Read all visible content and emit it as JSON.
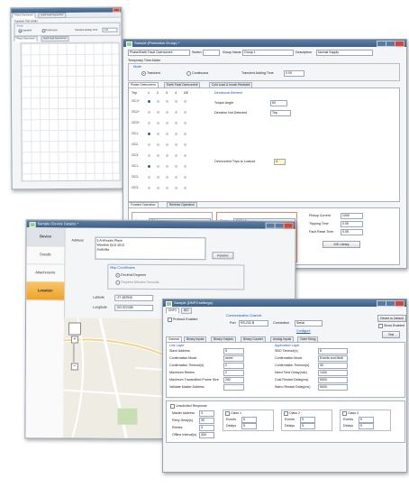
{
  "windows": {
    "transient": {
      "title": "Transient Time Adder",
      "tabs": [
        "Phase Overcurrent",
        "Earth Fault Overcurrent",
        "Settings"
      ],
      "menu": [
        "Group",
        "Graph"
      ],
      "mode_labels": [
        "Transient",
        "Continuous"
      ],
      "adding_time_label": "Transient Adding Time",
      "adding_time_value": "0.00",
      "subtabs": [
        "Phase Overcurrent",
        "Earth Fault Overcurrent"
      ]
    },
    "protection": {
      "title": "Sample (Protection Group) *",
      "fields": {
        "name_label": "Phase/Earth Fault Overcurrent",
        "switch_label": "Switch",
        "group_name_label": "Group Name",
        "group_name_value": "Group 1",
        "description_label": "Description",
        "description_value": "Normal Supply"
      },
      "adder_title": "Temporary Time Adder",
      "mode_label": "Mode",
      "mode_options": [
        "Transient",
        "Continuous"
      ],
      "adding_time_label": "Transient Adding Time",
      "adding_time_value": "0.00",
      "tabs": [
        "Phase Overcurrent",
        "Earth Fault Overcurrent",
        "Cold Load & Inrush Restraint"
      ],
      "trip_header": [
        "Trip",
        "1",
        "2",
        "3",
        "4",
        "DE"
      ],
      "trip_rows": [
        "OC1+",
        "OC2+",
        "OC3+",
        "OC1-",
        "OC2-",
        "OC3-",
        "OC1-",
        "OC2-",
        "OC3-"
      ],
      "directional_title": "Directional Element",
      "torque_angle_label": "Torque Angle",
      "torque_angle_value": "60",
      "direction_label": "Direction Not Detected",
      "direction_value": "Trip",
      "lockout_label": "Overcurrent Trips to Lockout",
      "lockout_value": "4",
      "bottom_tabs": [
        "Forward Operation",
        "Reverse Operation"
      ],
      "curve_label": "Curve",
      "curve_value_1": "IEC I",
      "curve_value_2": "ANSI VI",
      "pickup_label": "Pickup Current",
      "pickup_value": "1000",
      "tripping_label": "Tripping Time",
      "tripping_value": "0.05",
      "fault_reset_label": "Fault Reset Time",
      "fault_reset_value": "0.05",
      "library_button": "IDE Library"
    },
    "device": {
      "title": "Sample (Device Details) *",
      "nav": [
        "Device",
        "Details",
        "Attachments",
        "Location"
      ],
      "address_label": "Address",
      "address_lines": [
        "5 Ardmoulin Place",
        "Wavetek QLD 4010",
        "Australia"
      ],
      "resolve_button": "Resolve",
      "map_coordinates_label": "Map Coordinates",
      "coord_options": [
        "Decimal Degrees",
        "Degrees Minutes Seconds"
      ],
      "latitude_label": "Latitude",
      "latitude_value": "-27.482946",
      "longitude_label": "Longitude",
      "longitude_value": "153.022408"
    },
    "dnp": {
      "title": "Sample (DNP3 settings)",
      "tabs": [
        "DNP3",
        "IEC"
      ],
      "protocol_enabled_label": "Protocol Enabled",
      "channel_title": "Communication Channel",
      "port_label": "Port",
      "port_value": "RS-232 B",
      "connection_label": "Connection",
      "connection_value": "Serial",
      "configure_link": "Configure",
      "revert_button": "Revert to Default",
      "show_enabled_label": "Show Enabled",
      "test_button": "Test",
      "subtabs": [
        "General",
        "Binary Inputs",
        "Binary Outputs",
        "Binary Counter",
        "Analog Inputs",
        "Octet String"
      ],
      "link_layer_title": "Link Layer",
      "link_fields": [
        {
          "label": "Slave Address",
          "value": "5"
        },
        {
          "label": "Confirmation Mode",
          "value": "never"
        },
        {
          "label": "Confirmation Timeout(s)",
          "value": "2"
        },
        {
          "label": "Maximum Retries",
          "value": "2"
        },
        {
          "label": "Maximum Transmitted Frame Size",
          "value": "292"
        },
        {
          "label": "Validate Master Address",
          "value": ""
        }
      ],
      "app_layer_title": "Application Layer",
      "app_fields": [
        {
          "label": "SBO Timeout(s)",
          "value": "5"
        },
        {
          "label": "Confirmation Mode",
          "value": "Events and Multi"
        },
        {
          "label": "Confirmation Timeout(s)",
          "value": "30"
        },
        {
          "label": "Need Time Delay(min)",
          "value": "1440"
        },
        {
          "label": "Cold Restart Delay(ms)",
          "value": "5000"
        },
        {
          "label": "Warm Restart Delay(ms)",
          "value": "5000"
        }
      ],
      "unsolicited_title": "Unsolicited Response",
      "unsol_fields": [
        {
          "label": "Master Address",
          "value": "3"
        },
        {
          "label": "Retry Delay(s)",
          "value": "30"
        },
        {
          "label": "Retries",
          "value": "3"
        },
        {
          "label": "Offline Interval(s)",
          "value": "300"
        }
      ],
      "class_labels": [
        "Class 1",
        "Class 2",
        "Class 3"
      ],
      "events_label": "Events",
      "delays_label": "Delays",
      "class_values": [
        "5",
        "5",
        "5",
        "5",
        "5",
        "5"
      ]
    }
  },
  "colors": {
    "titlebar": "#3e5f86",
    "nav_active": "#eea32a",
    "link_blue": "#1f55b5"
  }
}
